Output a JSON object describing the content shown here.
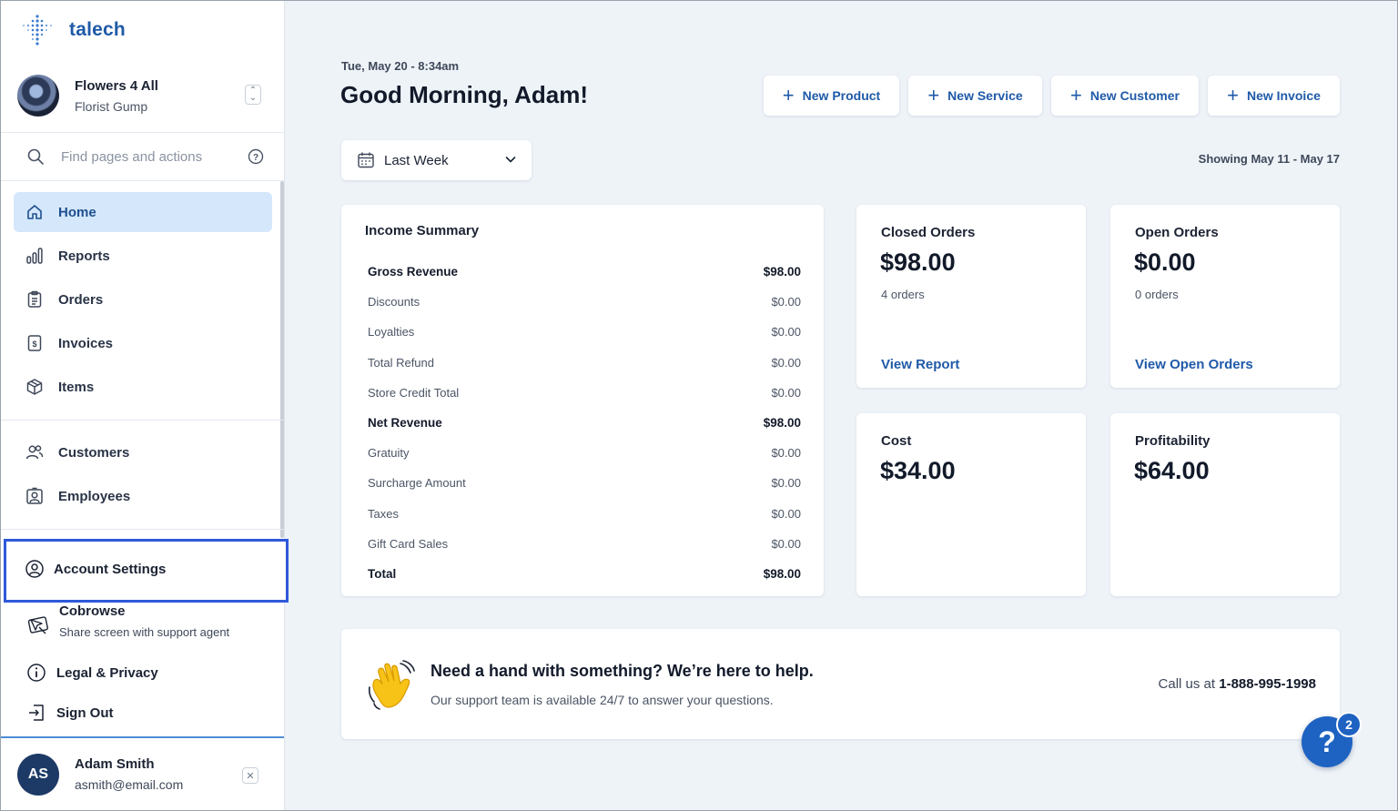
{
  "colors": {
    "accent": "#1f5aa8",
    "active_bg": "#d4e7fb",
    "highlight_border": "#2f59d9",
    "fab": "#1e63c2"
  },
  "brand": {
    "name": "talech",
    "logo_icon": "talech-logo-icon"
  },
  "store": {
    "name": "Flowers 4 All",
    "subtitle": "Florist Gump"
  },
  "search": {
    "placeholder": "Find pages and actions"
  },
  "nav": {
    "items": [
      {
        "label": "Home",
        "icon": "home-icon",
        "active": true
      },
      {
        "label": "Reports",
        "icon": "bar-chart-icon"
      },
      {
        "label": "Orders",
        "icon": "clipboard-icon"
      },
      {
        "label": "Invoices",
        "icon": "invoice-icon"
      },
      {
        "label": "Items",
        "icon": "box-icon"
      },
      {
        "label": "Customers",
        "icon": "users-icon"
      },
      {
        "label": "Employees",
        "icon": "badge-icon"
      }
    ]
  },
  "footer_nav": {
    "account_settings": "Account Settings",
    "cobrowse_title": "Cobrowse",
    "cobrowse_sub": "Share screen with support agent",
    "legal": "Legal & Privacy",
    "signout": "Sign Out"
  },
  "user": {
    "initials": "AS",
    "name": "Adam Smith",
    "email": "asmith@email.com"
  },
  "header": {
    "date": "Tue, May 20 - 8:34am",
    "greeting": "Good Morning, Adam!",
    "actions": [
      "New Product",
      "New Service",
      "New Customer",
      "New Invoice"
    ]
  },
  "range": {
    "selected": "Last Week",
    "showing": "Showing May 11 - May 17"
  },
  "income": {
    "title": "Income Summary",
    "rows": [
      {
        "label": "Gross Revenue",
        "value": "$98.00",
        "bold": true
      },
      {
        "label": "Discounts",
        "value": "$0.00"
      },
      {
        "label": "Loyalties",
        "value": "$0.00"
      },
      {
        "label": "Total Refund",
        "value": "$0.00"
      },
      {
        "label": "Store Credit Total",
        "value": "$0.00"
      },
      {
        "label": "Net Revenue",
        "value": "$98.00",
        "bold": true
      },
      {
        "label": "Gratuity",
        "value": "$0.00"
      },
      {
        "label": "Surcharge Amount",
        "value": "$0.00"
      },
      {
        "label": "Taxes",
        "value": "$0.00"
      },
      {
        "label": "Gift Card Sales",
        "value": "$0.00"
      },
      {
        "label": "Total",
        "value": "$98.00",
        "bold": true
      }
    ]
  },
  "metrics": {
    "closed": {
      "title": "Closed Orders",
      "value": "$98.00",
      "sub": "4 orders",
      "link": "View Report"
    },
    "open": {
      "title": "Open Orders",
      "value": "$0.00",
      "sub": "0 orders",
      "link": "View Open Orders"
    },
    "cost": {
      "title": "Cost",
      "value": "$34.00"
    },
    "profit": {
      "title": "Profitability",
      "value": "$64.00"
    }
  },
  "help": {
    "title": "Need a hand with something? We’re here to help.",
    "subtitle": "Our support team is available 24/7 to answer your questions.",
    "call_prefix": "Call us at ",
    "phone": "1-888-995-1998"
  },
  "fab": {
    "glyph": "?",
    "badge": "2"
  }
}
